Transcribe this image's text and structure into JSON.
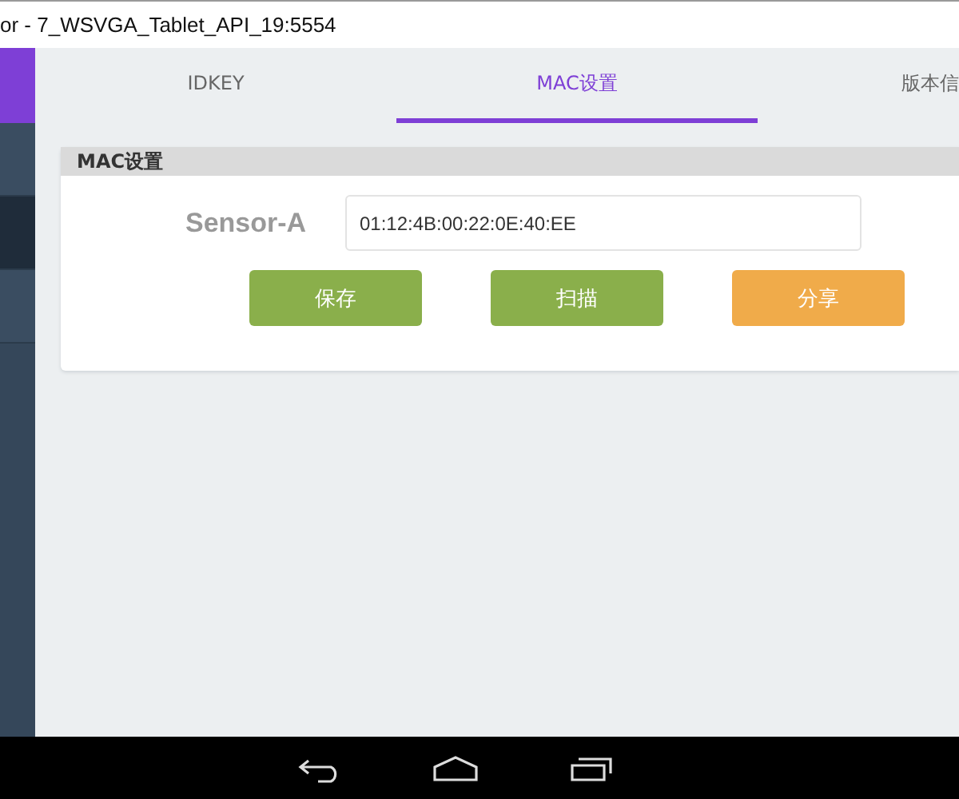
{
  "window": {
    "title": "or - 7_WSVGA_Tablet_API_19:5554"
  },
  "sidebar": {
    "items": [
      {
        "selected": false
      },
      {
        "selected": true
      },
      {
        "selected": false
      }
    ]
  },
  "tabs": [
    {
      "label": "IDKEY",
      "selected": false
    },
    {
      "label": "MAC设置",
      "selected": true
    },
    {
      "label": "版本信",
      "selected": false
    }
  ],
  "card": {
    "title": "MAC设置",
    "field": {
      "label": "Sensor-A",
      "value": "01:12:4B:00:22:0E:40:EE"
    },
    "buttons": [
      {
        "label": "保存",
        "kind": "primary"
      },
      {
        "label": "扫描",
        "kind": "primary"
      },
      {
        "label": "分享",
        "kind": "accent"
      }
    ]
  },
  "nav_bar": {
    "buttons": [
      {
        "kind": "back"
      },
      {
        "kind": "home"
      },
      {
        "kind": "recents"
      }
    ]
  }
}
